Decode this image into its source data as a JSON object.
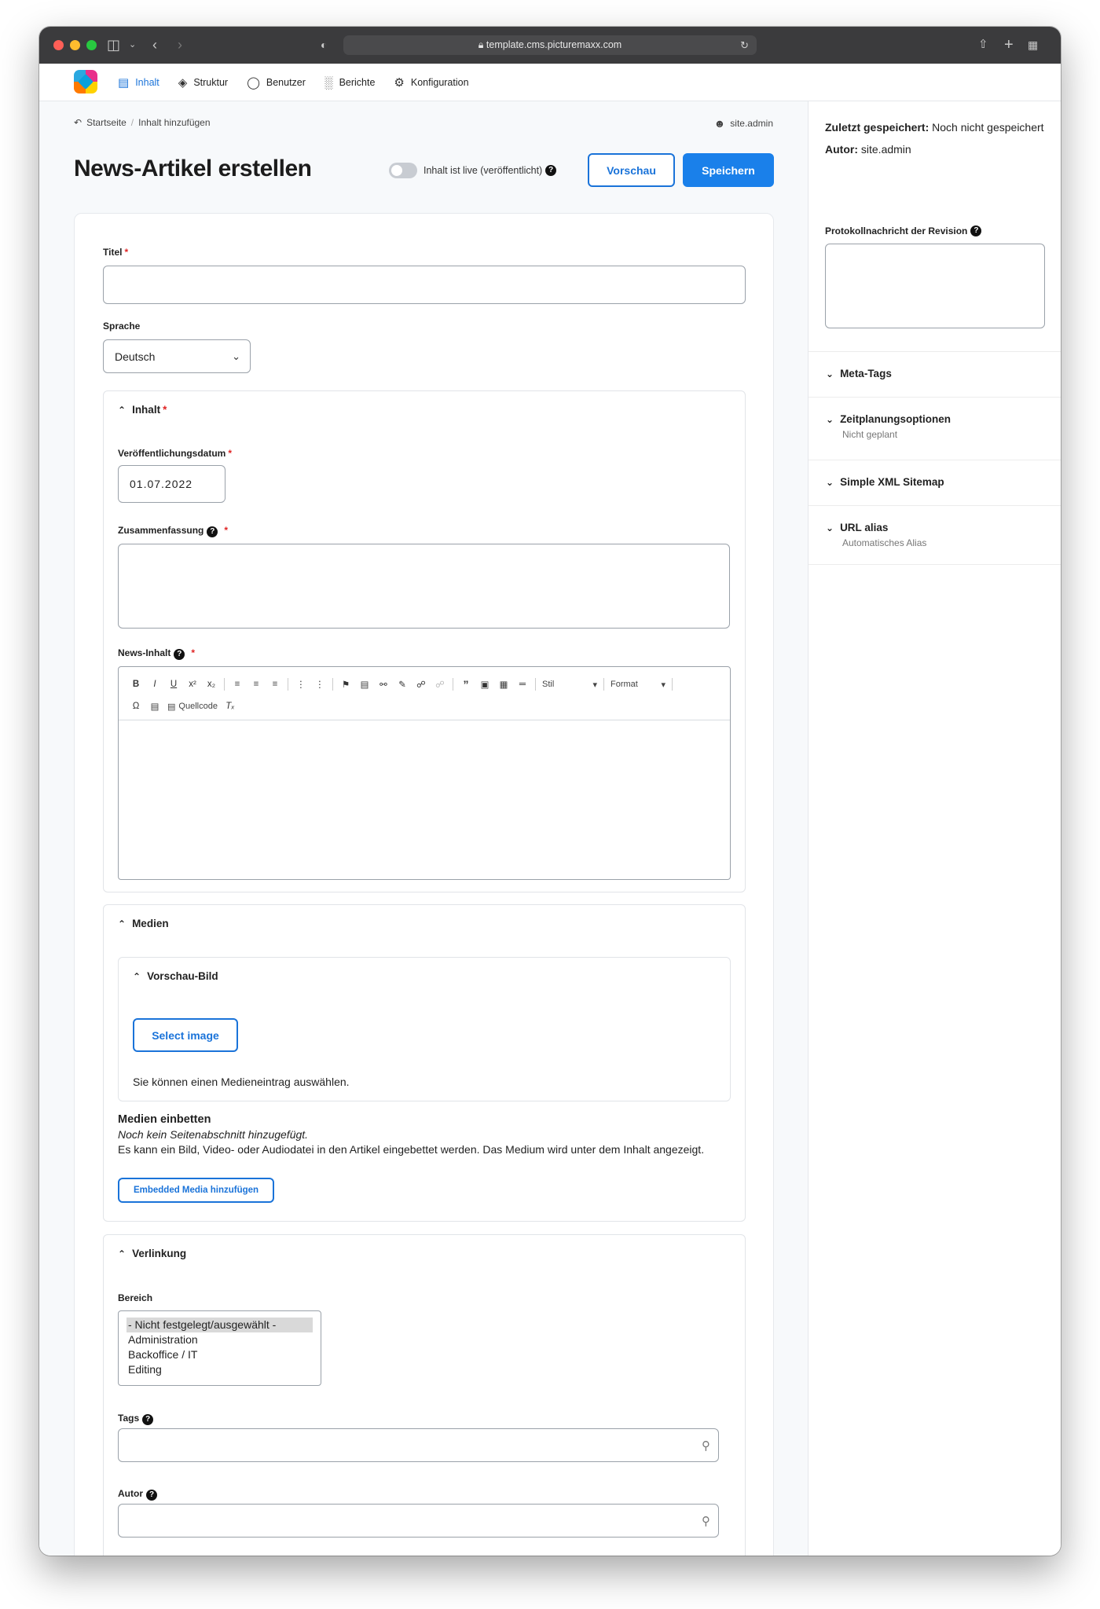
{
  "browser": {
    "url": "template.cms.picturemaxx.com"
  },
  "nav": {
    "items": [
      {
        "label": "Inhalt",
        "icon": "document-icon"
      },
      {
        "label": "Struktur",
        "icon": "layers-icon"
      },
      {
        "label": "Benutzer",
        "icon": "user-icon"
      },
      {
        "label": "Berichte",
        "icon": "bar-chart-icon"
      },
      {
        "label": "Konfiguration",
        "icon": "gear-icon"
      }
    ],
    "accent": "#1a73d9"
  },
  "breadcrumb": {
    "home": "Startseite",
    "separator": "/",
    "current": "Inhalt hinzufügen"
  },
  "user": {
    "name": "site.admin"
  },
  "header": {
    "title": "News-Artikel erstellen",
    "live_toggle_label": "Inhalt ist live (veröffentlicht)",
    "preview_label": "Vorschau",
    "save_label": "Speichern"
  },
  "form": {
    "title_label": "Titel",
    "language_label": "Sprache",
    "language_value": "Deutsch",
    "content_section": "Inhalt",
    "pub_date_label": "Veröffentlichungsdatum",
    "pub_date_value": "01.07.2022",
    "summary_label": "Zusammenfassung",
    "news_content_label": "News-Inhalt",
    "editor": {
      "style_label": "Stil",
      "format_label": "Format",
      "source_label": "Quellcode"
    },
    "media_section": "Medien",
    "preview_image_section": "Vorschau-Bild",
    "select_image_label": "Select image",
    "select_image_help": "Sie können einen Medieneintrag auswählen.",
    "embed_title": "Medien einbetten",
    "embed_empty": "Noch kein Seitenabschnitt hinzugefügt.",
    "embed_help": "Es kann ein Bild, Video- oder Audiodatei in den Artikel eingebettet werden. Das Medium wird unter dem Inhalt angezeigt.",
    "embed_button": "Embedded Media hinzufügen",
    "linking_section": "Verlinkung",
    "area_label": "Bereich",
    "area_options": [
      "- Nicht festgelegt/ausgewählt -",
      "Administration",
      "Backoffice / IT",
      "Editing"
    ],
    "tags_label": "Tags",
    "author_label": "Autor"
  },
  "sidebar": {
    "last_saved_label": "Zuletzt gespeichert:",
    "last_saved_value": "Noch nicht gespeichert",
    "author_label": "Autor:",
    "author_value": "site.admin",
    "revision_label": "Protokollnachricht der Revision",
    "sections": [
      {
        "title": "Meta-Tags",
        "subtitle": ""
      },
      {
        "title": "Zeitplanungsoptionen",
        "subtitle": "Nicht geplant"
      },
      {
        "title": "Simple XML Sitemap",
        "subtitle": ""
      },
      {
        "title": "URL alias",
        "subtitle": "Automatisches Alias"
      }
    ]
  }
}
